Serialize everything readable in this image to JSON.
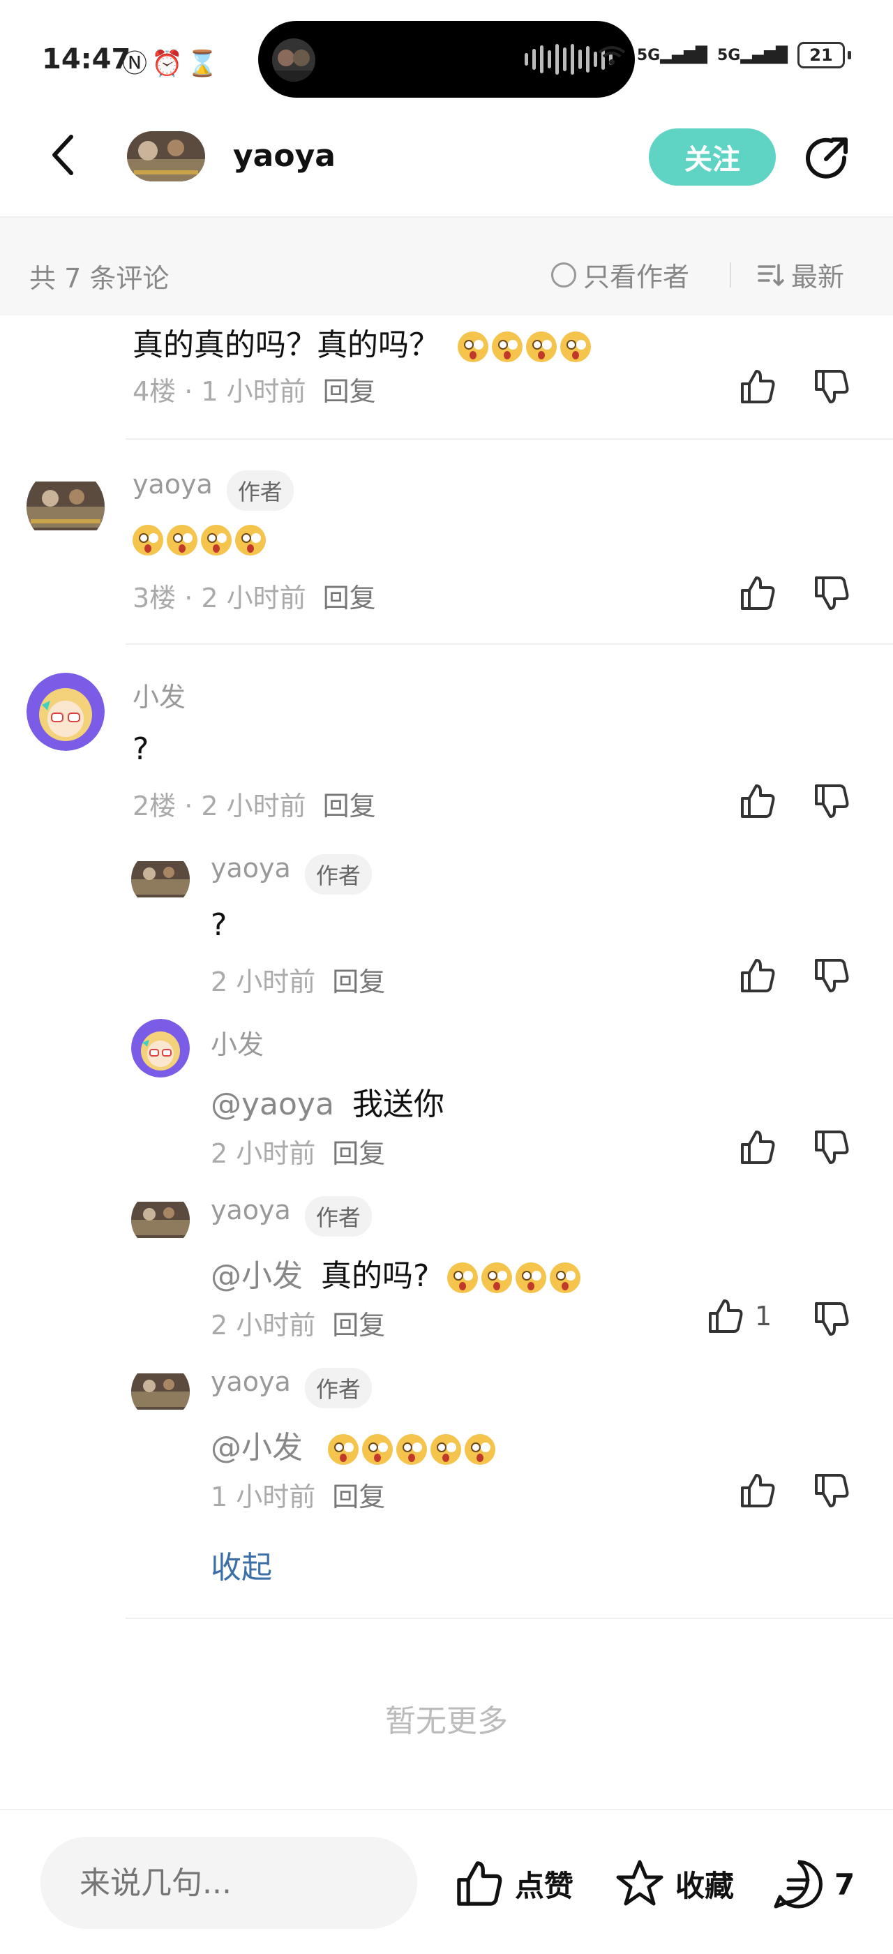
{
  "status_bar": {
    "time": "14:47",
    "battery": "21",
    "signal1": "5G",
    "signal2": "5G"
  },
  "header": {
    "username": "yaoya",
    "follow_label": "关注"
  },
  "comment_bar": {
    "total_label": "共 7 条评论",
    "only_author_label": "只看作者",
    "sort_label": "最新"
  },
  "comments": [
    {
      "text": "真的真的吗？真的吗？",
      "emoji_count": 4,
      "meta": "4楼 · 1 小时前",
      "reply_label": "回复"
    },
    {
      "username": "yaoya",
      "badge": "作者",
      "emoji_count": 4,
      "meta": "3楼 · 2 小时前",
      "reply_label": "回复"
    },
    {
      "username": "小发",
      "text": "?",
      "meta": "2楼 · 2 小时前",
      "reply_label": "回复"
    }
  ],
  "replies": [
    {
      "username": "yaoya",
      "badge": "作者",
      "text": "?",
      "meta": "2 小时前",
      "reply_label": "回复"
    },
    {
      "username": "小发",
      "mention": "@yaoya",
      "text": "我送你",
      "meta": "2 小时前",
      "reply_label": "回复"
    },
    {
      "username": "yaoya",
      "badge": "作者",
      "mention": "@小发",
      "text": "真的吗?",
      "emoji_count": 4,
      "meta": "2 小时前",
      "reply_label": "回复",
      "like_count": "1"
    },
    {
      "username": "yaoya",
      "badge": "作者",
      "mention": "@小发",
      "emoji_count": 5,
      "meta": "1 小时前",
      "reply_label": "回复"
    }
  ],
  "collapse_label": "收起",
  "no_more_label": "暂无更多",
  "bottom_bar": {
    "input_placeholder": "来说几句...",
    "like_label": "点赞",
    "favorite_label": "收藏",
    "comment_count": "7"
  },
  "colors": {
    "follow": "#5fd4c4",
    "collapse_link": "#3c6fa8",
    "avatar_purple": "#7b5ce6"
  },
  "icons": [
    "back-arrow-icon",
    "share-icon",
    "radio-icon",
    "sort-icon",
    "thumb-up-icon",
    "thumb-down-icon",
    "star-icon",
    "comment-icon",
    "alarm-icon",
    "nfc-icon",
    "hourglass-icon",
    "wifi-icon",
    "signal-icon",
    "battery-icon"
  ]
}
